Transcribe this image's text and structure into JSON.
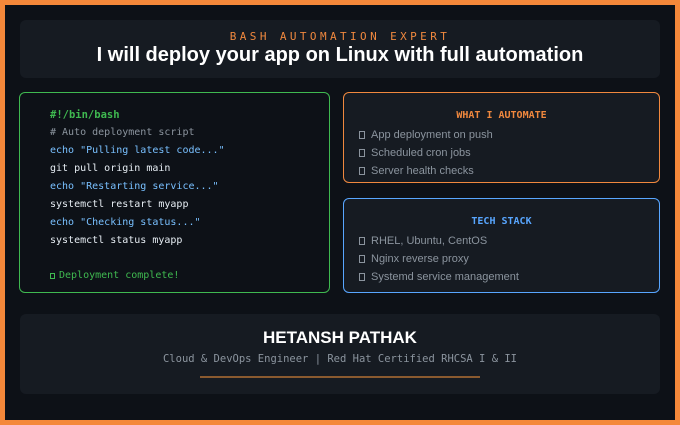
{
  "header": {
    "kicker": "BASH AUTOMATION EXPERT",
    "headline": "I will deploy your app on Linux with full automation"
  },
  "code": {
    "shebang": "#!/bin/bash",
    "comment": "# Auto deployment script",
    "echo_pull": "echo \"Pulling latest code...\"",
    "cmd_pull": "git pull origin main",
    "echo_restart": "echo \"Restarting service...\"",
    "cmd_restart": "systemctl restart myapp",
    "echo_status": "echo \"Checking status...\"",
    "cmd_status": "systemctl status myapp",
    "done": "Deployment complete!"
  },
  "automate": {
    "title": "WHAT I AUTOMATE",
    "items": [
      "App deployment on push",
      "Scheduled cron jobs",
      "Server health checks"
    ]
  },
  "stack": {
    "title": "TECH STACK",
    "items": [
      "RHEL, Ubuntu, CentOS",
      "Nginx reverse proxy",
      "Systemd service management"
    ]
  },
  "footer": {
    "name": "HETANSH PATHAK",
    "role": "Cloud & DevOps Engineer | Red Hat Certified RHCSA I & II"
  },
  "colors": {
    "frame": "#f4883a",
    "accent_orange": "#f0883e",
    "accent_green": "#3fb950",
    "accent_blue": "#58a6ff",
    "background": "#0d1117"
  }
}
